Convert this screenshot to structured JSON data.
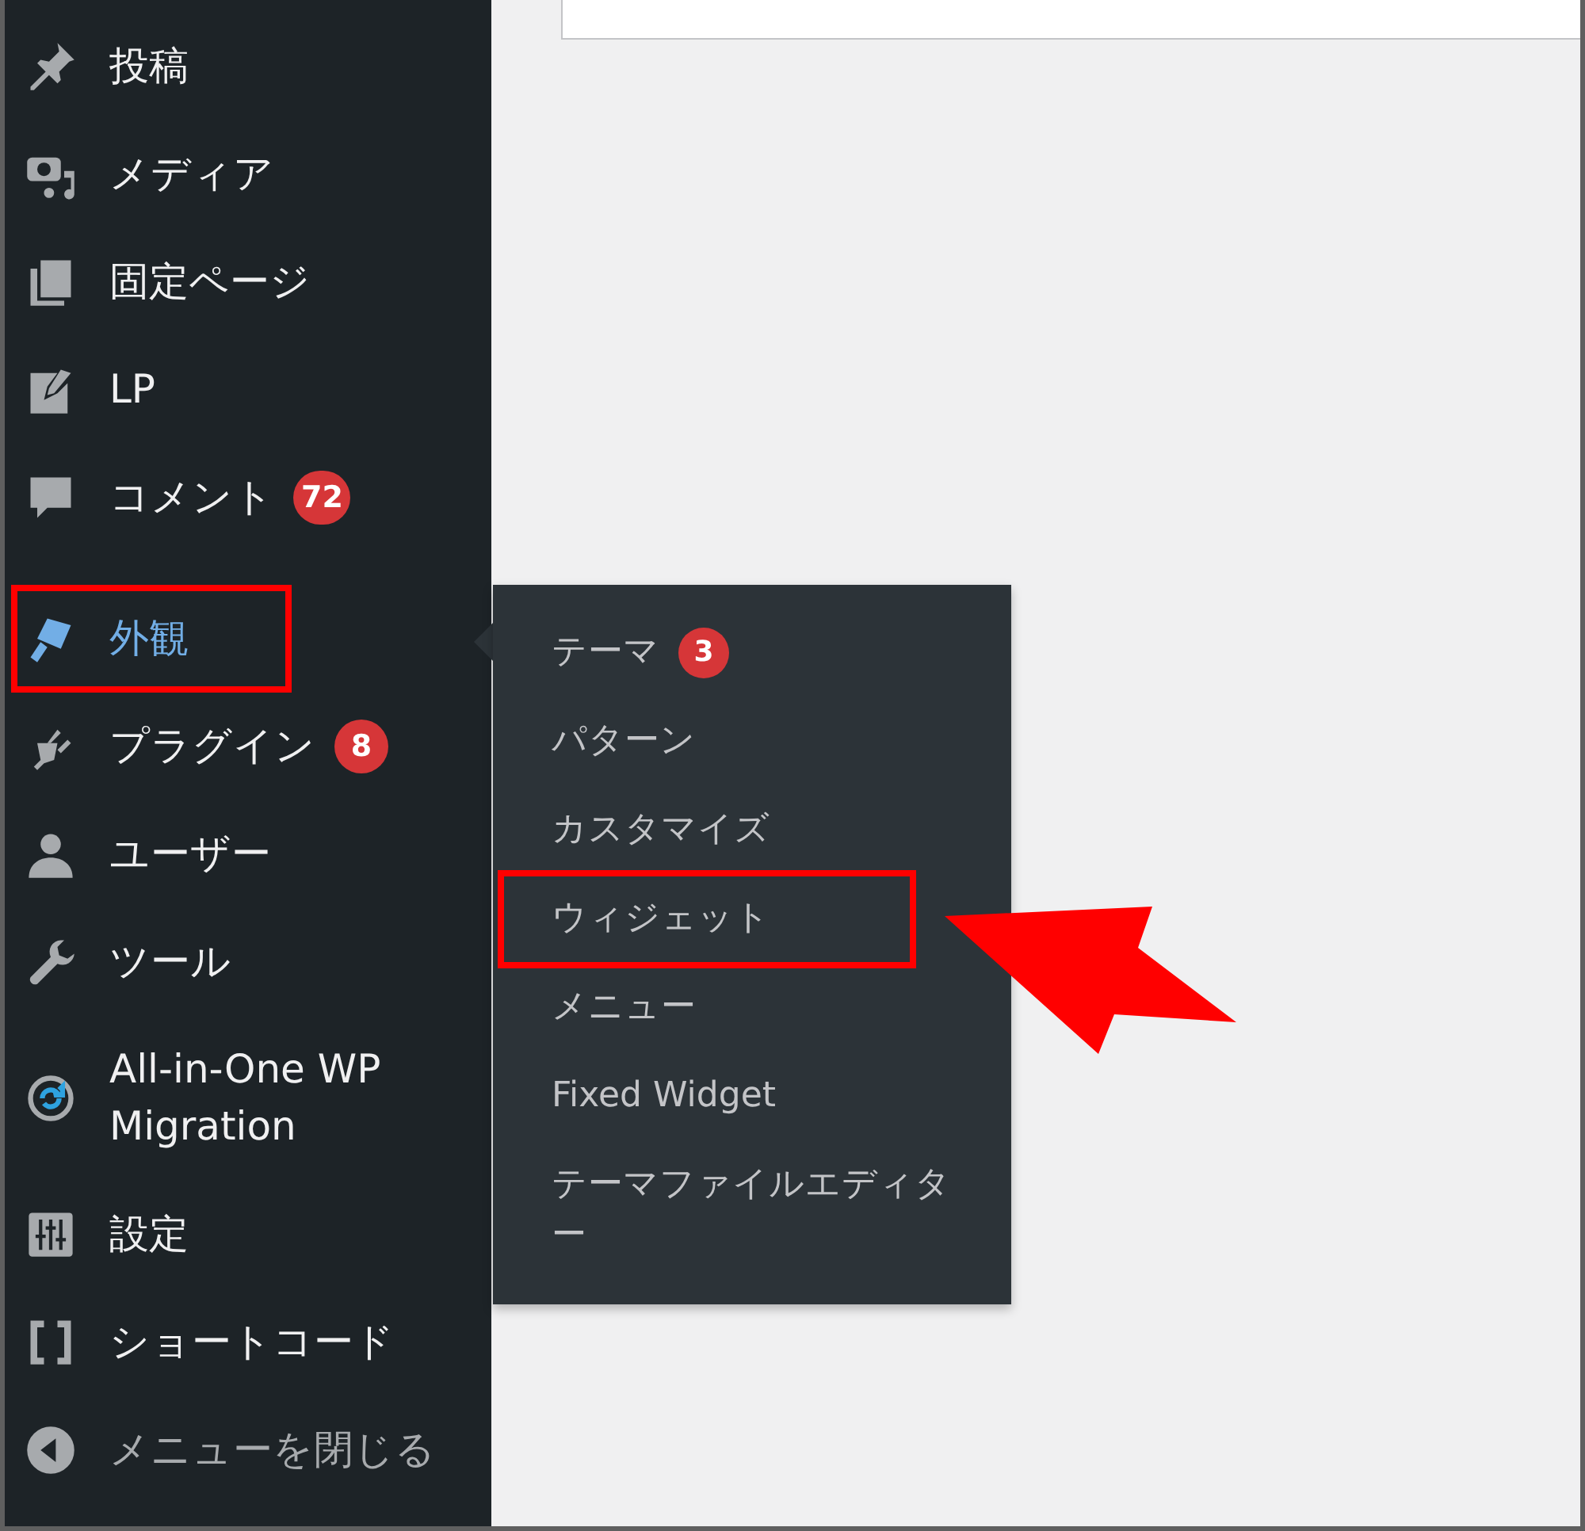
{
  "sidebar": {
    "groups": [
      [
        {
          "kind": "menu",
          "label": "投稿",
          "selected": false,
          "highlighted": false
        },
        {
          "kind": "menu",
          "label": "メディア",
          "selected": false,
          "highlighted": false
        },
        {
          "kind": "menu",
          "label": "固定ページ",
          "selected": false,
          "highlighted": false
        },
        {
          "kind": "menu",
          "label": "LP",
          "selected": false,
          "highlighted": false
        },
        {
          "kind": "menu",
          "label": "コメント",
          "badge": "72",
          "selected": false,
          "highlighted": false
        }
      ],
      [
        {
          "kind": "menu",
          "label": "外観",
          "selected": true,
          "highlighted": true,
          "submenu": {
            "items": [
              {
                "label": "テーマ",
                "badge": "3",
                "highlighted": false,
                "arrow": false
              },
              {
                "label": "パターン",
                "highlighted": false,
                "arrow": false
              },
              {
                "label": "カスタマイズ",
                "highlighted": false,
                "arrow": false
              },
              {
                "label": "ウィジェット",
                "highlighted": true,
                "arrow": true
              },
              {
                "label": "メニュー",
                "highlighted": false,
                "arrow": false
              },
              {
                "label": "Fixed Widget",
                "highlighted": false,
                "arrow": false
              },
              {
                "label": "テーマファイルエディター",
                "highlighted": false,
                "arrow": false
              }
            ]
          }
        },
        {
          "kind": "menu",
          "label": "プラグイン",
          "badge": "8",
          "selected": false,
          "highlighted": false
        },
        {
          "kind": "menu",
          "label": "ユーザー",
          "selected": false,
          "highlighted": false
        },
        {
          "kind": "menu",
          "label": "ツール",
          "selected": false,
          "highlighted": false
        },
        {
          "kind": "menu",
          "label": "All-in-One WP Migration",
          "selected": false,
          "highlighted": false
        },
        {
          "kind": "menu",
          "label": "設定",
          "selected": false,
          "highlighted": false
        },
        {
          "kind": "menu",
          "label": "ショートコード",
          "selected": false,
          "highlighted": false
        },
        {
          "kind": "collapse",
          "label": "メニューを閉じる",
          "selected": false,
          "highlighted": false
        }
      ]
    ]
  }
}
